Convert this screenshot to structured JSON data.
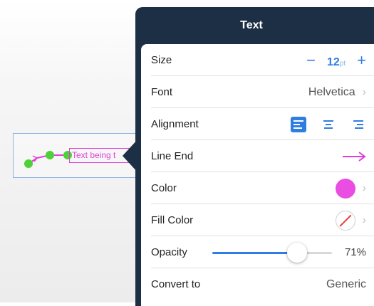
{
  "annotation": {
    "text_preview": "Text being t",
    "color": "#e03fd7",
    "handle_color": "#4cd137"
  },
  "panel": {
    "title": "Text",
    "rows": {
      "size": {
        "label": "Size",
        "minus": "−",
        "value": "12",
        "unit": "pt",
        "plus": "+"
      },
      "font": {
        "label": "Font",
        "value": "Helvetica",
        "chevron": "›"
      },
      "alignment": {
        "label": "Alignment",
        "options": [
          "left",
          "center",
          "right"
        ],
        "selected": "left"
      },
      "line_end": {
        "label": "Line End",
        "style": "open-arrow"
      },
      "color": {
        "label": "Color",
        "swatch": "#e94de1",
        "chevron": "›"
      },
      "fill_color": {
        "label": "Fill Color",
        "swatch": "none",
        "chevron": "›"
      },
      "opacity": {
        "label": "Opacity",
        "value": 0.71,
        "display": "71%"
      },
      "convert_to": {
        "label": "Convert to",
        "value": "Generic"
      }
    }
  },
  "colors": {
    "panel_header": "#1c2f45",
    "accent": "#2f7de1",
    "line_end_arrow": "#e03fd7"
  }
}
